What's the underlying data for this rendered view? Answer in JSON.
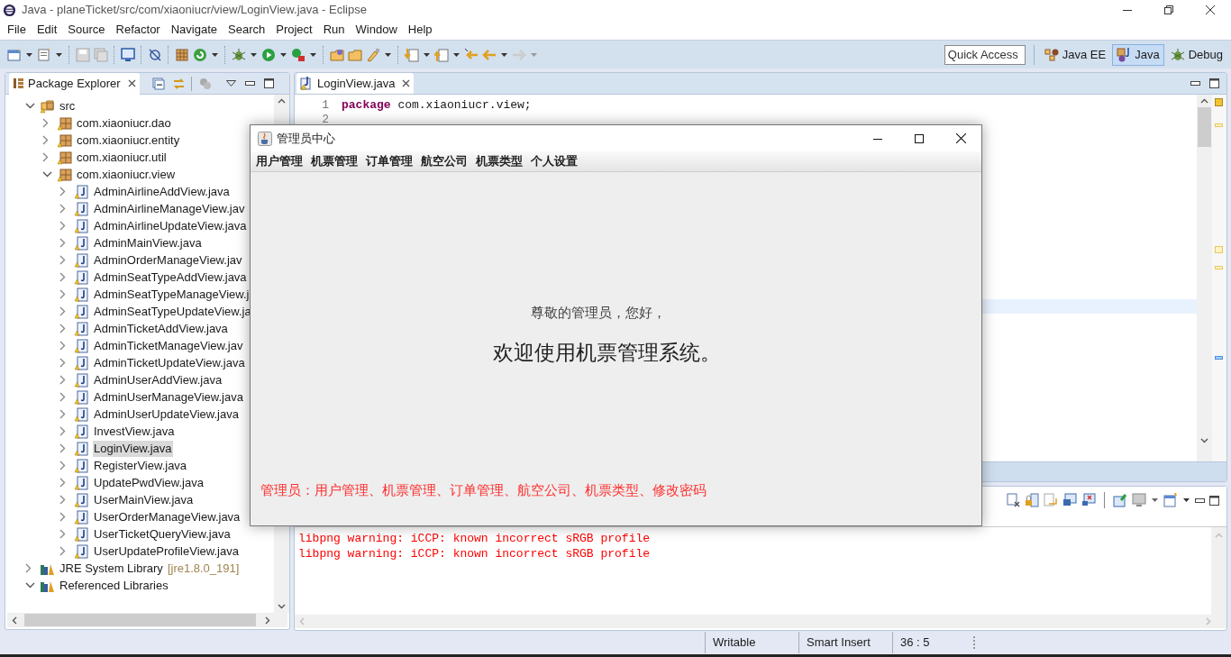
{
  "window": {
    "title": "Java - planeTicket/src/com/xiaoniucr/view/LoginView.java - Eclipse"
  },
  "menu": [
    "File",
    "Edit",
    "Source",
    "Refactor",
    "Navigate",
    "Search",
    "Project",
    "Run",
    "Window",
    "Help"
  ],
  "quick_access": {
    "placeholder": "Quick Access"
  },
  "perspectives": [
    {
      "label": "Java EE",
      "selected": false
    },
    {
      "label": "Java",
      "selected": true
    },
    {
      "label": "Debug",
      "selected": false
    }
  ],
  "package_explorer": {
    "title": "Package Explorer",
    "tree": [
      {
        "label": "src",
        "kind": "folder",
        "expanded": true,
        "selected": false,
        "children": [
          {
            "label": "com.xiaoniucr.dao",
            "kind": "package",
            "expanded": false,
            "selected": false
          },
          {
            "label": "com.xiaoniucr.entity",
            "kind": "package",
            "expanded": false,
            "selected": false
          },
          {
            "label": "com.xiaoniucr.util",
            "kind": "package",
            "expanded": false,
            "selected": false
          },
          {
            "label": "com.xiaoniucr.view",
            "kind": "package",
            "expanded": true,
            "selected": false,
            "children": [
              {
                "label": "AdminAirlineAddView.java",
                "kind": "file",
                "expanded": false,
                "selected": false
              },
              {
                "label": "AdminAirlineManageView.jav",
                "kind": "file",
                "expanded": false,
                "selected": false
              },
              {
                "label": "AdminAirlineUpdateView.java",
                "kind": "file",
                "expanded": false,
                "selected": false
              },
              {
                "label": "AdminMainView.java",
                "kind": "file",
                "expanded": false,
                "selected": false
              },
              {
                "label": "AdminOrderManageView.jav",
                "kind": "file",
                "expanded": false,
                "selected": false
              },
              {
                "label": "AdminSeatTypeAddView.java",
                "kind": "file",
                "expanded": false,
                "selected": false
              },
              {
                "label": "AdminSeatTypeManageView.j",
                "kind": "file",
                "expanded": false,
                "selected": false
              },
              {
                "label": "AdminSeatTypeUpdateView.ja",
                "kind": "file",
                "expanded": false,
                "selected": false
              },
              {
                "label": "AdminTicketAddView.java",
                "kind": "file",
                "expanded": false,
                "selected": false
              },
              {
                "label": "AdminTicketManageView.jav",
                "kind": "file",
                "expanded": false,
                "selected": false
              },
              {
                "label": "AdminTicketUpdateView.java",
                "kind": "file",
                "expanded": false,
                "selected": false
              },
              {
                "label": "AdminUserAddView.java",
                "kind": "file",
                "expanded": false,
                "selected": false
              },
              {
                "label": "AdminUserManageView.java",
                "kind": "file",
                "expanded": false,
                "selected": false
              },
              {
                "label": "AdminUserUpdateView.java",
                "kind": "file",
                "expanded": false,
                "selected": false
              },
              {
                "label": "InvestView.java",
                "kind": "file",
                "expanded": false,
                "selected": false
              },
              {
                "label": "LoginView.java",
                "kind": "file",
                "expanded": false,
                "selected": true
              },
              {
                "label": "RegisterView.java",
                "kind": "file",
                "expanded": false,
                "selected": false
              },
              {
                "label": "UpdatePwdView.java",
                "kind": "file",
                "expanded": false,
                "selected": false
              },
              {
                "label": "UserMainView.java",
                "kind": "file",
                "expanded": false,
                "selected": false
              },
              {
                "label": "UserOrderManageView.java",
                "kind": "file",
                "expanded": false,
                "selected": false
              },
              {
                "label": "UserTicketQueryView.java",
                "kind": "file",
                "expanded": false,
                "selected": false
              },
              {
                "label": "UserUpdateProfileView.java",
                "kind": "file",
                "expanded": false,
                "selected": false
              }
            ]
          }
        ]
      },
      {
        "label": "JRE System Library",
        "decoration": "[jre1.8.0_191]",
        "kind": "library",
        "expanded": false,
        "selected": false
      },
      {
        "label": "Referenced Libraries",
        "kind": "library",
        "expanded": true,
        "selected": false
      }
    ]
  },
  "editor": {
    "tab": "LoginView.java",
    "lines": [
      {
        "number": "1",
        "keyword": "package",
        "code": " com.xiaoniucr.view;"
      },
      {
        "number": "2"
      }
    ]
  },
  "console": {
    "lines": [
      "libpng warning: iCCP: known incorrect sRGB profile",
      "libpng warning: iCCP: known incorrect sRGB profile"
    ]
  },
  "status_bar": [
    "Writable",
    "Smart Insert",
    "36 : 5"
  ],
  "dialog": {
    "title": "管理员中心",
    "menu": [
      "用户管理",
      "机票管理",
      "订单管理",
      "航空公司",
      "机票类型",
      "个人设置"
    ],
    "greeting": "尊敬的管理员，您好，",
    "welcome": "欢迎使用机票管理系统。",
    "footer": "管理员：用户管理、机票管理、订单管理、航空公司、机票类型、修改密码"
  }
}
